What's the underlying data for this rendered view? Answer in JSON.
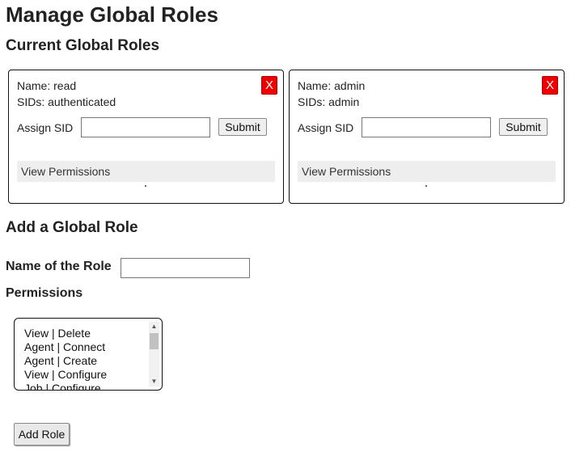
{
  "page": {
    "title": "Manage Global Roles",
    "current_section_title": "Current Global Roles",
    "add_section_title": "Add a Global Role"
  },
  "roles": [
    {
      "name": "Name: read",
      "sids": "SIDs: authenticated",
      "delete_label": "X",
      "assign_label": "Assign SID",
      "assign_value": "",
      "submit_label": "Submit",
      "permissions_label": "View Permissions"
    },
    {
      "name": "Name: admin",
      "sids": "SIDs: admin",
      "delete_label": "X",
      "assign_label": "Assign SID",
      "assign_value": "",
      "submit_label": "Submit",
      "permissions_label": "View Permissions"
    }
  ],
  "add_form": {
    "role_name_label": "Name of the Role",
    "role_name_value": "",
    "permissions_label": "Permissions",
    "permission_options": [
      "View | Delete",
      "Agent | Connect",
      "Agent | Create",
      "View | Configure",
      "Job | Configure"
    ],
    "add_button_label": "Add Role"
  },
  "colors": {
    "delete_button": "#ee0000",
    "permissions_bar": "#eeeeee"
  }
}
